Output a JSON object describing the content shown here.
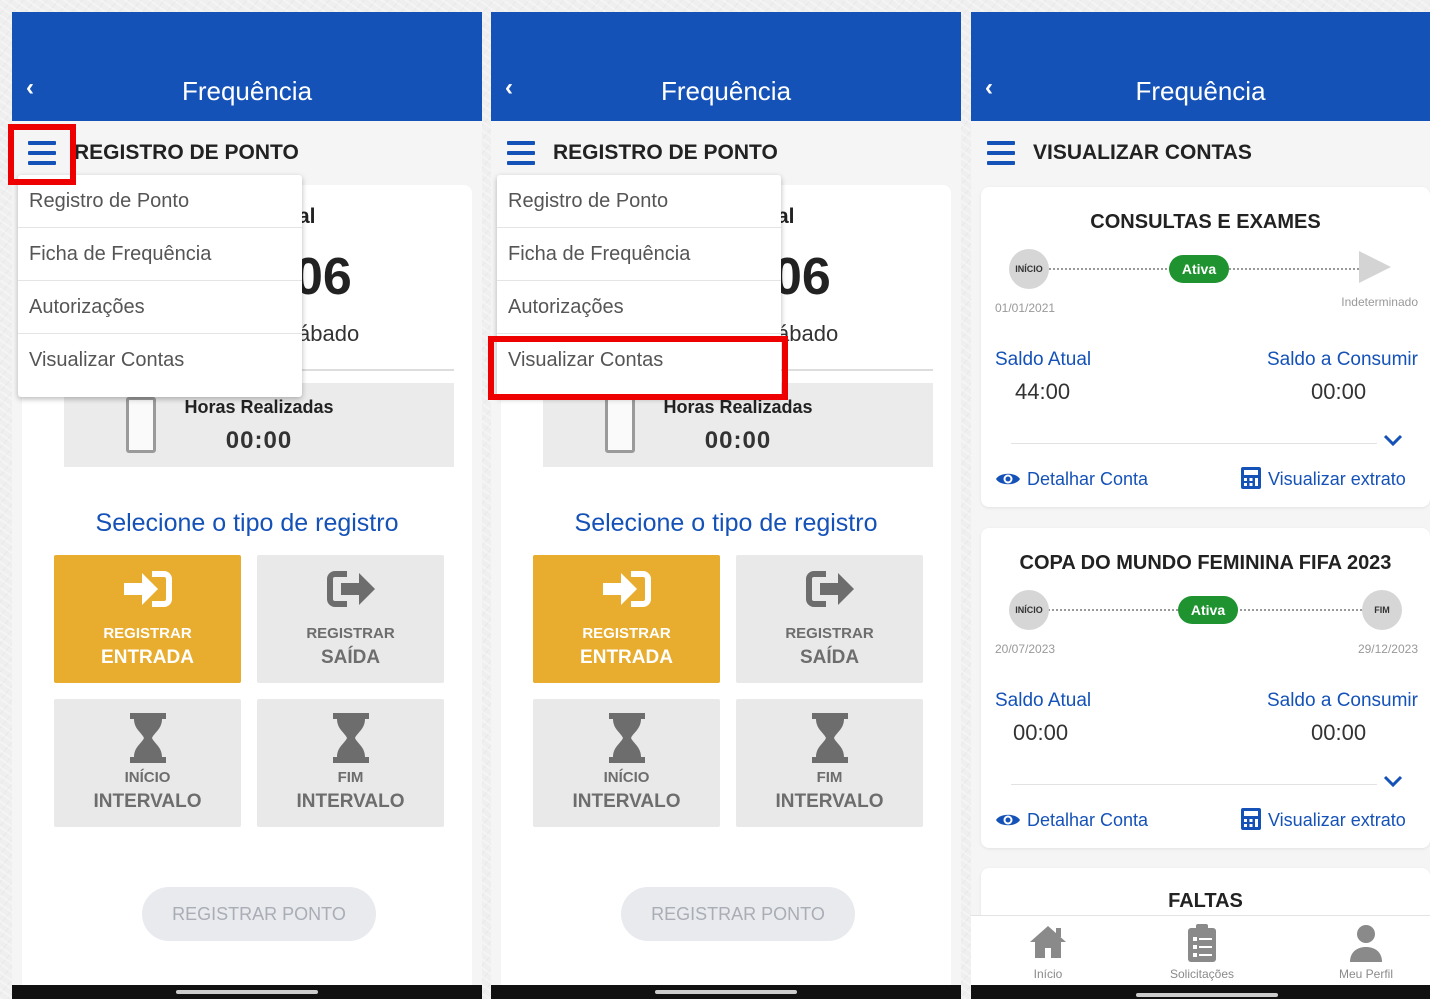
{
  "app": {
    "title": "Frequência",
    "back_icon": "chevron-left-icon"
  },
  "colors": {
    "primary": "#1552b8",
    "accent": "#e8ad2e",
    "success": "#1e9330",
    "highlight": "#ee0000"
  },
  "registro": {
    "section_title": "REGISTRO DE PONTO",
    "card_header_partial": "al",
    "day_number_partial": "06",
    "weekday_partial": "ábado",
    "hours_label": "Horas Realizadas",
    "hours_value": "00:00",
    "select_title": "Selecione o tipo de registro",
    "tiles": [
      {
        "line1": "REGISTRAR",
        "line2": "ENTRADA",
        "icon": "sign-in-icon"
      },
      {
        "line1": "REGISTRAR",
        "line2": "SAÍDA",
        "icon": "sign-out-icon"
      },
      {
        "line1": "INÍCIO",
        "line2": "INTERVALO",
        "icon": "hourglass-icon"
      },
      {
        "line1": "FIM",
        "line2": "INTERVALO",
        "icon": "hourglass-icon"
      }
    ],
    "register_button": "REGISTRAR PONTO"
  },
  "menu": {
    "items": [
      "Registro de Ponto",
      "Ficha de Frequência",
      "Autorizações",
      "Visualizar Contas"
    ]
  },
  "contas": {
    "section_title": "VISUALIZAR CONTAS",
    "accounts": [
      {
        "title": "CONSULTAS E EXAMES",
        "start_label": "INÍCIO",
        "status": "Ativa",
        "start_date": "01/01/2021",
        "end_date": "Indeterminado",
        "saldo_atual_label": "Saldo Atual",
        "saldo_atual": "44:00",
        "saldo_consumir_label": "Saldo a Consumir",
        "saldo_consumir": "00:00",
        "detail_link": "Detalhar Conta",
        "statement_link": "Visualizar extrato"
      },
      {
        "title": "COPA DO MUNDO FEMININA FIFA 2023",
        "start_label": "INÍCIO",
        "end_label": "FIM",
        "status": "Ativa",
        "start_date": "20/07/2023",
        "end_date": "29/12/2023",
        "saldo_atual_label": "Saldo Atual",
        "saldo_atual": "00:00",
        "saldo_consumir_label": "Saldo a Consumir",
        "saldo_consumir": "00:00",
        "detail_link": "Detalhar Conta",
        "statement_link": "Visualizar extrato"
      },
      {
        "title": "FALTAS"
      }
    ]
  },
  "bottom_nav": [
    {
      "label": "Início",
      "icon": "home-icon"
    },
    {
      "label": "Solicitações",
      "icon": "clipboard-list-icon"
    },
    {
      "label": "Meu Perfil",
      "icon": "user-icon"
    }
  ]
}
